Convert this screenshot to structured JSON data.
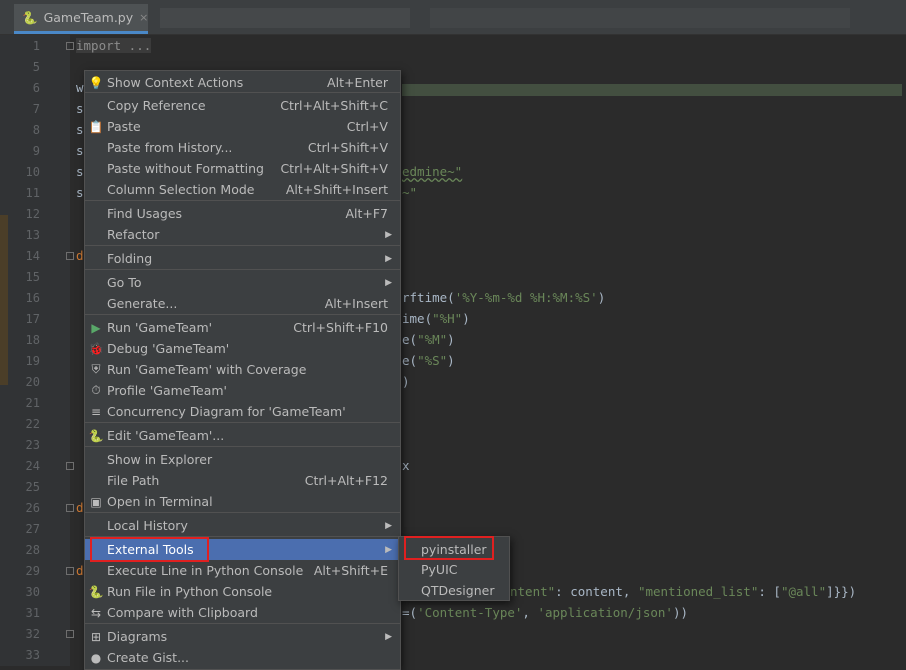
{
  "tab": {
    "filename": "GameTeam.py",
    "close": "×"
  },
  "gutter": {
    "line_numbers": [
      "1",
      "5",
      "6",
      "7",
      "8",
      "9",
      "10",
      "11",
      "12",
      "13",
      "14",
      "15",
      "16",
      "17",
      "18",
      "19",
      "20",
      "21",
      "22",
      "23",
      "24",
      "25",
      "26",
      "27",
      "28",
      "29",
      "30",
      "31",
      "32",
      "33"
    ]
  },
  "code": {
    "line1": "import ...",
    "l6_start": "w",
    "l7_start": "s",
    "l8_start": "s",
    "l9_start": "s",
    "l10_start": "s",
    "l10_tail": "edmine~\"",
    "l11_start": "s",
    "l11_tail": "~\"",
    "l14_start": "d",
    "l16_tail_a": "rftime(",
    "l16_tail_b": "'%Y-%m-%d %H:%M:%S'",
    "l16_tail_c": ")",
    "l17_tail_a": "ime(",
    "l17_tail_b": "\"%H\"",
    "l17_tail_c": ")",
    "l18_tail_a": "e(",
    "l18_tail_b": "\"%M\"",
    "l18_tail_c": ")",
    "l19_tail_a": "e(",
    "l19_tail_b": "\"%S\"",
    "l19_tail_c": ")",
    "l20_tail": ")",
    "l24_tail": "x",
    "l26_start": "d",
    "l29_start": "d",
    "l30_tail_a": "ntent\"",
    "l30_tail_b": ": content, ",
    "l30_tail_c": "\"mentioned_list\"",
    "l30_tail_d": ": [",
    "l30_tail_e": "\"@all\"",
    "l30_tail_f": "]}})",
    "l31_tail_a": "=(",
    "l31_tail_b": "'Content-Type'",
    "l31_tail_c": ", ",
    "l31_tail_d": "'application/json'",
    "l31_tail_e": "))"
  },
  "context_menu": {
    "items": [
      {
        "label": "Show Context Actions",
        "shortcut": "Alt+Enter",
        "icon": "lightbulb-icon",
        "glyph": "💡"
      },
      {
        "label": "Copy Reference",
        "shortcut": "Ctrl+Alt+Shift+C",
        "icon": "",
        "glyph": ""
      },
      {
        "label": "Paste",
        "shortcut": "Ctrl+V",
        "icon": "clipboard-icon",
        "glyph": "📋"
      },
      {
        "label": "Paste from History...",
        "shortcut": "Ctrl+Shift+V",
        "icon": "",
        "glyph": ""
      },
      {
        "label": "Paste without Formatting",
        "shortcut": "Ctrl+Alt+Shift+V",
        "icon": "",
        "glyph": ""
      },
      {
        "label": "Column Selection Mode",
        "shortcut": "Alt+Shift+Insert",
        "icon": "",
        "glyph": ""
      },
      {
        "label": "Find Usages",
        "shortcut": "Alt+F7",
        "icon": "",
        "glyph": ""
      },
      {
        "label": "Refactor",
        "shortcut": "",
        "icon": "",
        "glyph": ""
      },
      {
        "label": "Folding",
        "shortcut": "",
        "icon": "",
        "glyph": ""
      },
      {
        "label": "Go To",
        "shortcut": "",
        "icon": "",
        "glyph": ""
      },
      {
        "label": "Generate...",
        "shortcut": "Alt+Insert",
        "icon": "",
        "glyph": ""
      },
      {
        "label": "Run 'GameTeam'",
        "shortcut": "Ctrl+Shift+F10",
        "icon": "run-icon",
        "glyph": "▶"
      },
      {
        "label": "Debug 'GameTeam'",
        "shortcut": "",
        "icon": "debug-bug-icon",
        "glyph": "🐞"
      },
      {
        "label": "Run 'GameTeam' with Coverage",
        "shortcut": "",
        "icon": "coverage-shield-icon",
        "glyph": "⛨"
      },
      {
        "label": "Profile 'GameTeam'",
        "shortcut": "",
        "icon": "profile-icon",
        "glyph": "⏱"
      },
      {
        "label": "Concurrency Diagram for 'GameTeam'",
        "shortcut": "",
        "icon": "concurrency-icon",
        "glyph": "≡"
      },
      {
        "label": "Edit 'GameTeam'...",
        "shortcut": "",
        "icon": "python-icon",
        "glyph": "🐍"
      },
      {
        "label": "Show in Explorer",
        "shortcut": "",
        "icon": "",
        "glyph": ""
      },
      {
        "label": "File Path",
        "shortcut": "Ctrl+Alt+F12",
        "icon": "",
        "glyph": ""
      },
      {
        "label": "Open in Terminal",
        "shortcut": "",
        "icon": "terminal-icon",
        "glyph": "▣"
      },
      {
        "label": "Local History",
        "shortcut": "",
        "icon": "",
        "glyph": ""
      },
      {
        "label": "External Tools",
        "shortcut": "",
        "icon": "",
        "glyph": ""
      },
      {
        "label": "Execute Line in Python Console",
        "shortcut": "Alt+Shift+E",
        "icon": "",
        "glyph": ""
      },
      {
        "label": "Run File in Python Console",
        "shortcut": "",
        "icon": "python-icon",
        "glyph": "🐍"
      },
      {
        "label": "Compare with Clipboard",
        "shortcut": "",
        "icon": "compare-icon",
        "glyph": "⇆"
      },
      {
        "label": "Diagrams",
        "shortcut": "",
        "icon": "diagram-icon",
        "glyph": "⊞"
      },
      {
        "label": "Create Gist...",
        "shortcut": "",
        "icon": "github-icon",
        "glyph": "●"
      }
    ]
  },
  "submenu": {
    "items": [
      {
        "label": "pyinstaller"
      },
      {
        "label": "PyUIC"
      },
      {
        "label": "QTDesigner"
      }
    ]
  },
  "colors": {
    "selection": "#4b6eaf",
    "highlight_box": "#e02020",
    "string": "#6a8759"
  }
}
